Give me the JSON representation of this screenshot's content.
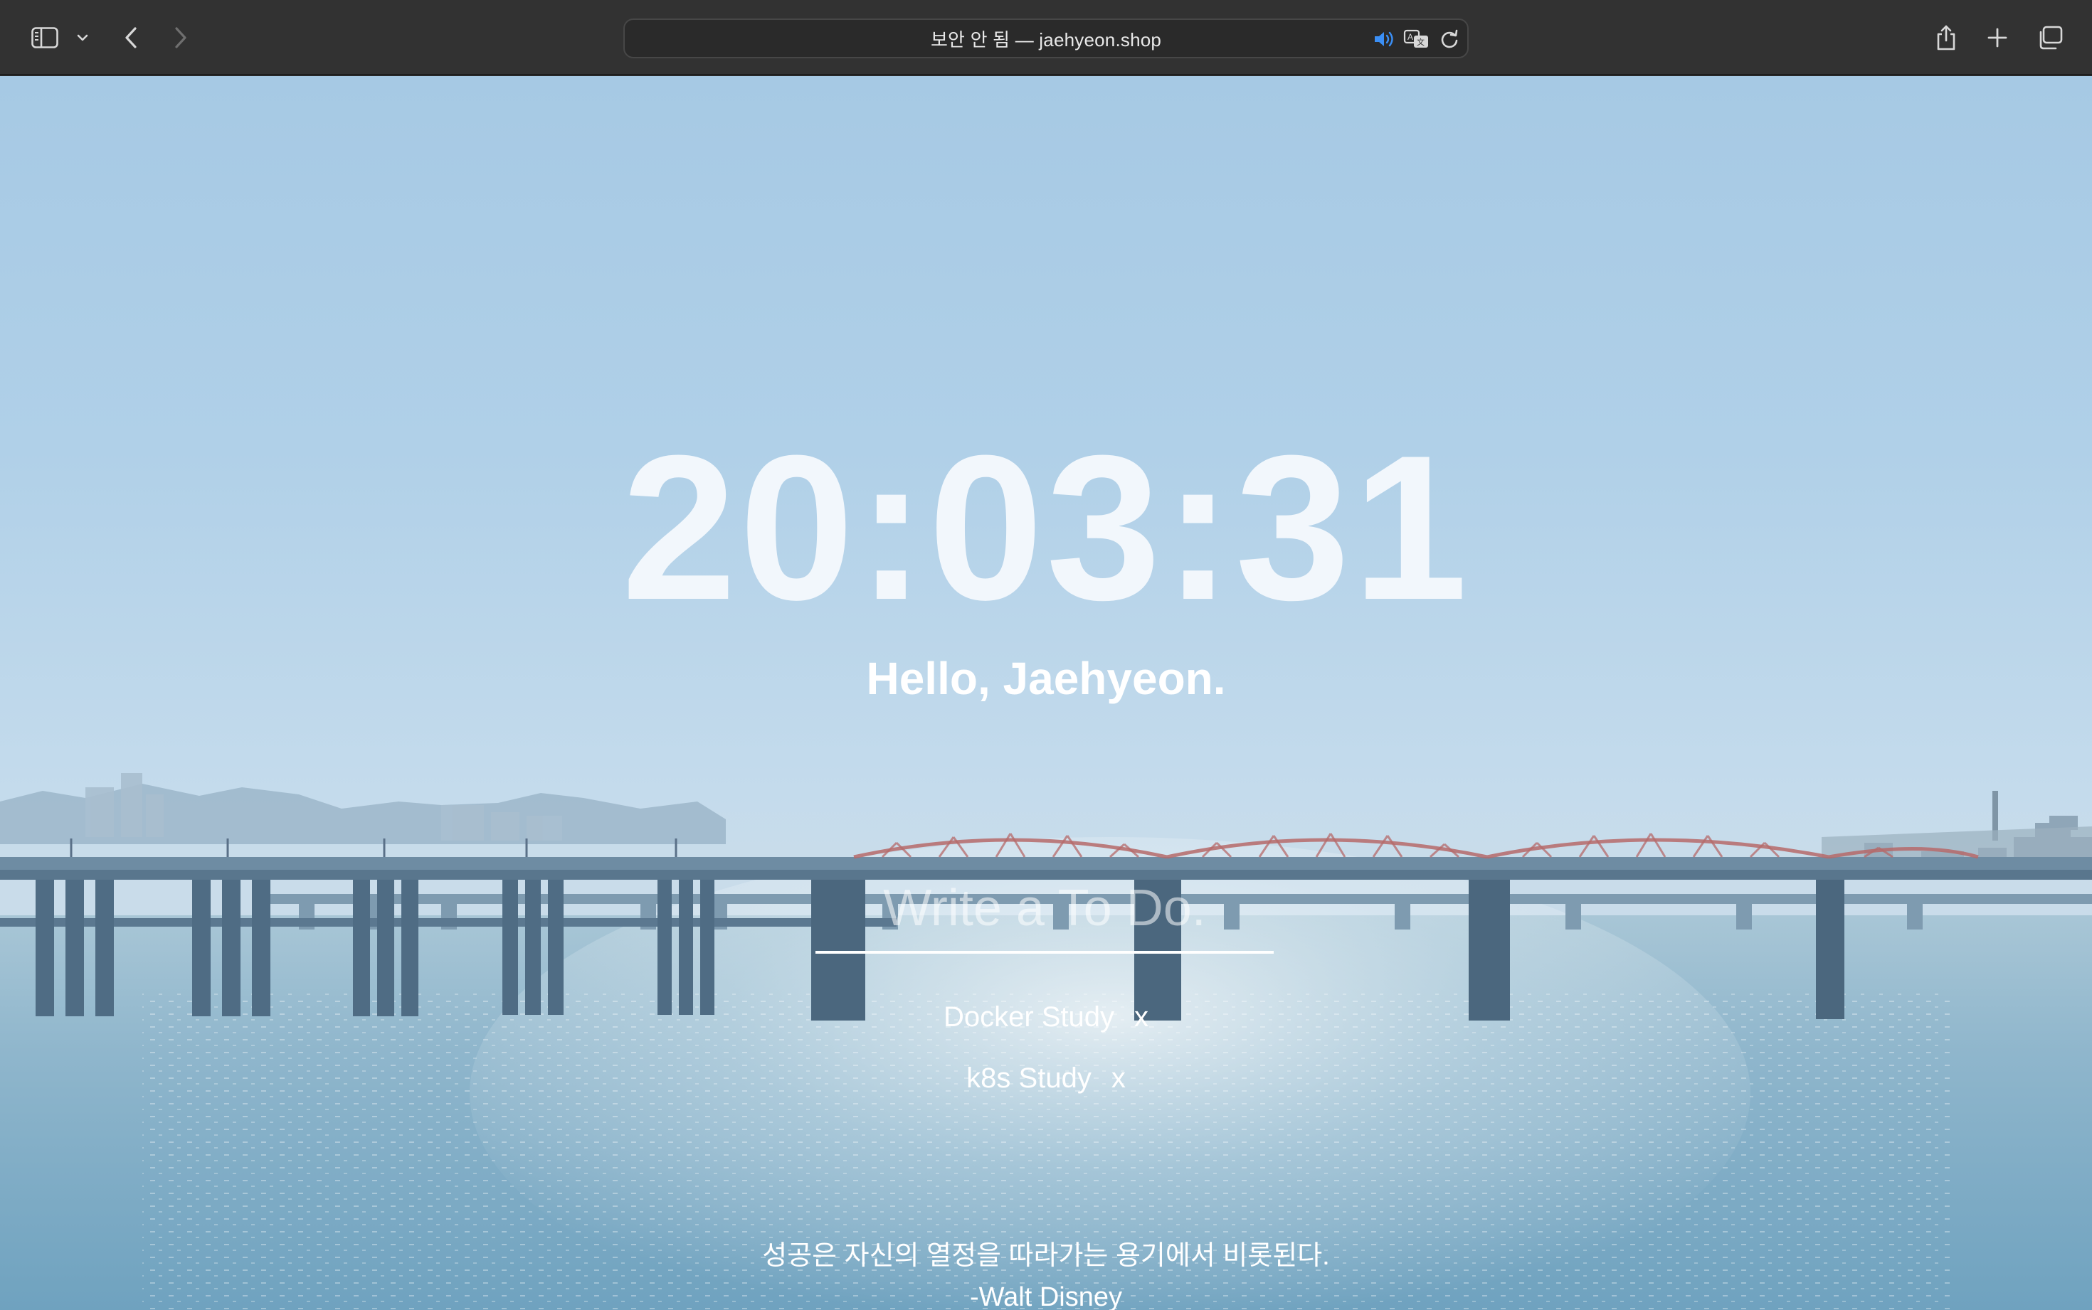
{
  "browser": {
    "address": "보안 안 됨 — jaehyeon.shop",
    "icons": {
      "sidebar": "sidebar-icon",
      "sidebar_menu": "chevron-down-icon",
      "back": "chevron-left-icon",
      "forward": "chevron-right-icon",
      "audio": "speaker-icon",
      "translate": "translate-icon",
      "reload": "reload-icon",
      "share": "share-icon",
      "new_tab": "plus-icon",
      "tab_overview": "tabs-overview-icon"
    },
    "accent_color": "#3b8ff5"
  },
  "page": {
    "clock": "20:03:31",
    "greeting": "Hello, Jaehyeon.",
    "todo_placeholder": "Write a To Do.",
    "todos": [
      {
        "text": "Docker Study",
        "delete_label": "x"
      },
      {
        "text": "k8s Study",
        "delete_label": "x"
      }
    ],
    "quote": {
      "text": "성공은 자신의 열정을 따라가는 용기에서 비롯된다.",
      "author": "-Walt Disney"
    }
  }
}
